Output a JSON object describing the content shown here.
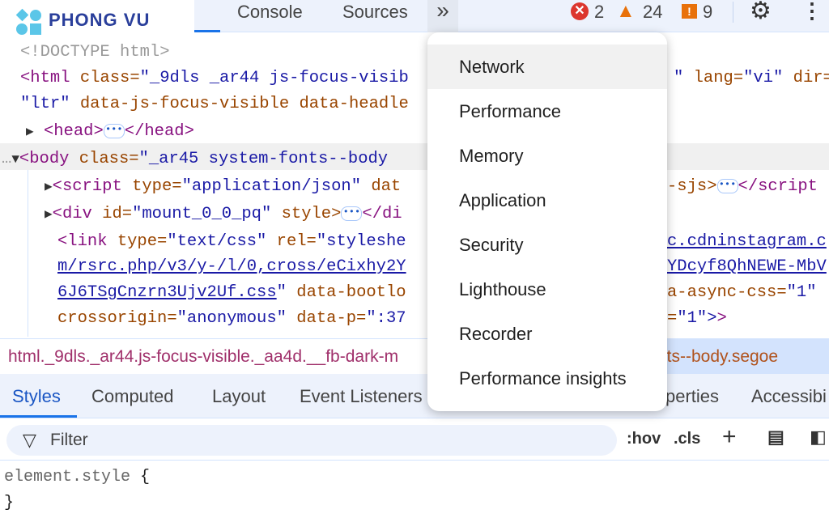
{
  "logo": {
    "text": "PHONG VU"
  },
  "toolbar": {
    "tabs": [
      "s",
      "Console",
      "Sources"
    ],
    "more_label": "»",
    "errors": "2",
    "warnings": "24",
    "issues": "9"
  },
  "code": {
    "l0": "<!DOCTYPE html>",
    "l1a": "<html ",
    "l1b": "class=",
    "l1c": "\"_9dls _ar44 js-focus-visib",
    "l1r1": "\" ",
    "l1r2": "lang=",
    "l1r3": "\"vi\" ",
    "l1r4": "dir=",
    "l2a": "\"ltr\" ",
    "l2b": "data-js-focus-visible data-headle",
    "l3a": "<head>",
    "l3b": "</head>",
    "l4a": "<body ",
    "l4b": "class=",
    "l4c": "\"_ar45 system-fonts--body",
    "l5a": "<script ",
    "l5b": "type=",
    "l5c": "\"application/json\" ",
    "l5d": "dat",
    "l5r1": "-sjs>",
    "l5r2": "</script",
    "l6a": "<div ",
    "l6b": "id=",
    "l6c": "\"mount_0_0_pq\" ",
    "l6d": "style>",
    "l6e": "</di",
    "l7a": "<link ",
    "l7b": "type=",
    "l7c": "\"text/css\" ",
    "l7d": "rel=",
    "l7e": "\"styleshe",
    "l7r": "c.cdninstagram.c",
    "l8a": "m/rsrc.php/v3/y-/l/0,cross/eCixhy2Y",
    "l8r": "YDcyf8QhNEWE-MbV",
    "l9a": "6J6TSgCnzrn3Ujv2Uf.css",
    "l9b": "\" ",
    "l9c": "data-bootlo",
    "l9r1": "a-async-css=",
    "l9r2": "\"1\"",
    "l10a": "crossorigin=",
    "l10b": "\"anonymous\" ",
    "l10c": "data-p=",
    "l10d": "\":37",
    "l10r1": "=",
    "l10r2": "\"1\">"
  },
  "breadcrumb": {
    "left": "html._9dls._ar44.js-focus-visible._aa4d.__fb-dark-m",
    "right": "nts--body.segoe"
  },
  "subtabs": [
    "Styles",
    "Computed",
    "Layout",
    "Event Listeners",
    "perties",
    "Accessibi"
  ],
  "filter": {
    "placeholder": "Filter",
    "hov": ":hov",
    "cls": ".cls"
  },
  "styles": {
    "selector": "element.style",
    "open": "{",
    "close": "}"
  },
  "menu": {
    "items": [
      "Network",
      "Performance",
      "Memory",
      "Application",
      "Security",
      "Lighthouse",
      "Recorder",
      "Performance insights"
    ]
  },
  "colors": {
    "accent": "#1a73e8",
    "error": "#dc362e",
    "warning": "#e8710a"
  }
}
